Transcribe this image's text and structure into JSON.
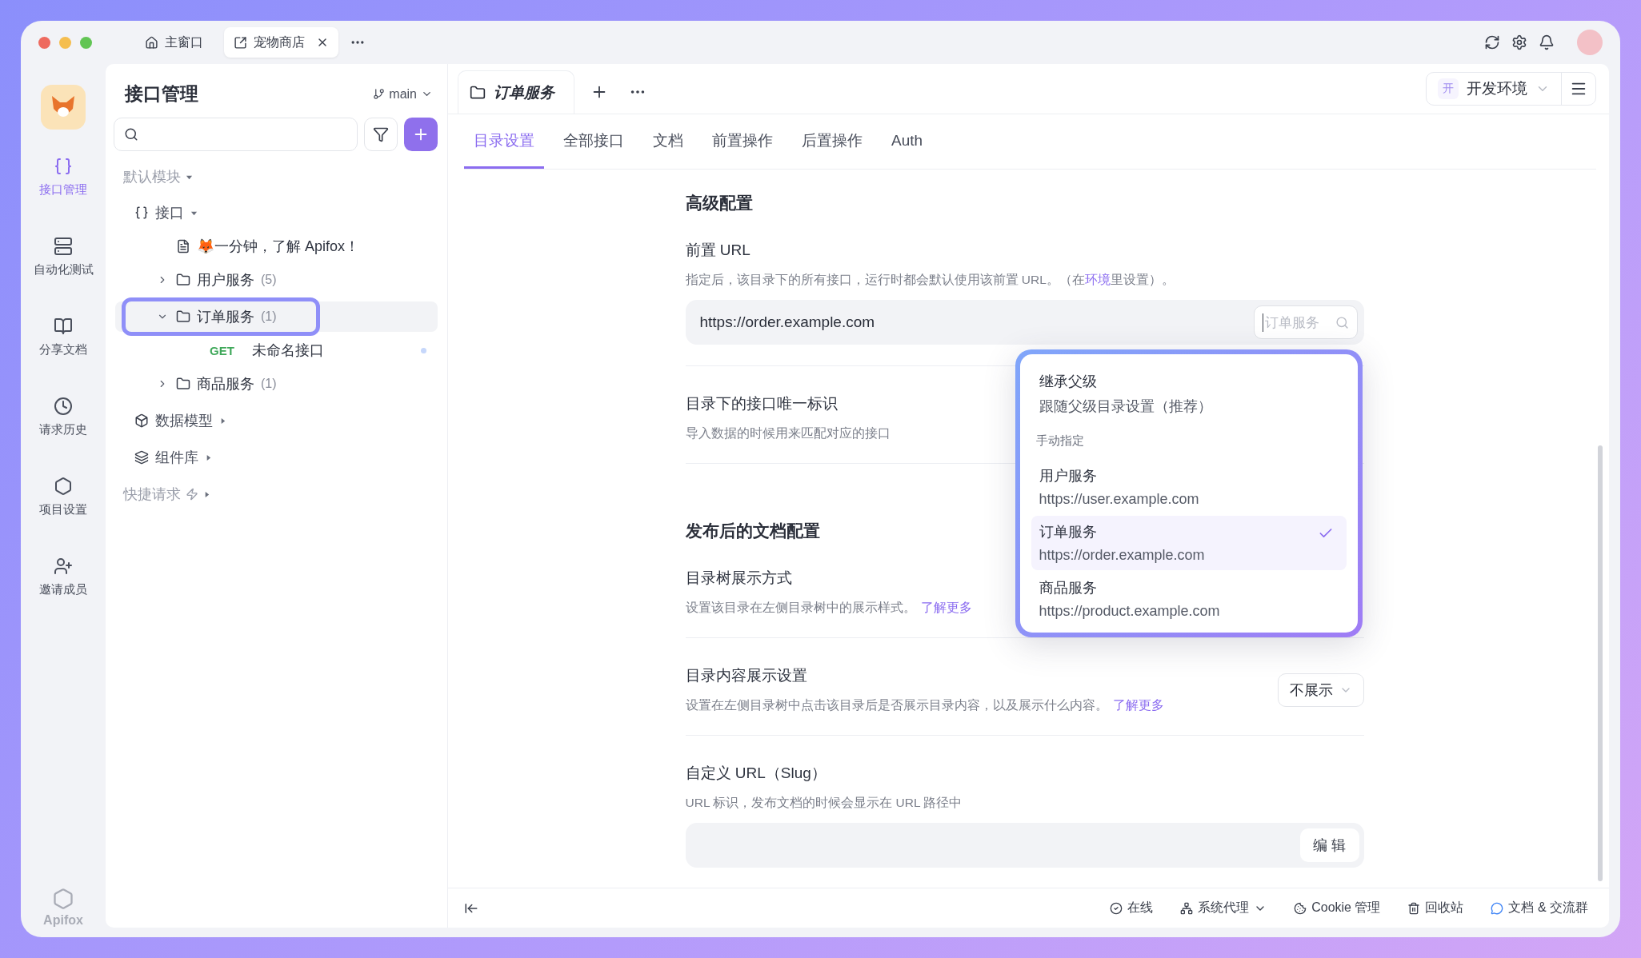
{
  "window": {
    "tabs": [
      {
        "label": "主窗口",
        "selected": false,
        "kind": "home"
      },
      {
        "label": "宠物商店",
        "selected": true,
        "kind": "project"
      }
    ]
  },
  "nav": {
    "items": [
      {
        "label": "接口管理",
        "selected": true
      },
      {
        "label": "自动化测试",
        "selected": false
      },
      {
        "label": "分享文档",
        "selected": false
      },
      {
        "label": "请求历史",
        "selected": false
      },
      {
        "label": "项目设置",
        "selected": false
      },
      {
        "label": "邀请成员",
        "selected": false
      }
    ],
    "brand": "Apifox"
  },
  "sidebar": {
    "title": "接口管理",
    "branch": "main",
    "module": "默认模块",
    "tree": [
      {
        "kind": "root",
        "label": "接口",
        "expanded": true,
        "children": [
          {
            "kind": "doc",
            "label": "🦊一分钟，了解 Apifox！"
          },
          {
            "kind": "folder",
            "label": "用户服务",
            "count": "(5)",
            "expanded": false,
            "selected": false
          },
          {
            "kind": "folder",
            "label": "订单服务",
            "count": "(1)",
            "expanded": true,
            "selected": true,
            "children": [
              {
                "kind": "endpoint",
                "method": "GET",
                "label": "未命名接口"
              }
            ]
          },
          {
            "kind": "folder",
            "label": "商品服务",
            "count": "(1)",
            "expanded": false,
            "selected": false
          }
        ]
      },
      {
        "kind": "root",
        "label": "数据模型",
        "expanded": false
      },
      {
        "kind": "root",
        "label": "组件库",
        "expanded": false
      }
    ],
    "quick": "快捷请求"
  },
  "main": {
    "doc_tab": "订单服务",
    "env_badge": "开",
    "env": "开发环境",
    "tabs": [
      {
        "label": "目录设置",
        "selected": true
      },
      {
        "label": "全部接口",
        "selected": false
      },
      {
        "label": "文档",
        "selected": false
      },
      {
        "label": "前置操作",
        "selected": false
      },
      {
        "label": "后置操作",
        "selected": false
      },
      {
        "label": "Auth",
        "selected": false
      }
    ],
    "advanced": {
      "heading": "高级配置",
      "base_url": {
        "label": "前置 URL",
        "desc_before": "指定后，该目录下的所有接口，运行时都会默认使用该前置 URL。（在",
        "desc_link": "环境",
        "desc_after": "里设置）。",
        "value": "https://order.example.com",
        "search_placeholder": "订单服务"
      },
      "unique_id": {
        "label": "目录下的接口唯一标识",
        "desc": "导入数据的时候用来匹配对应的接口"
      }
    },
    "publish": {
      "heading": "发布后的文档配置",
      "tree_style": {
        "label": "目录树展示方式",
        "desc": "设置该目录在左侧目录树中的展示样式。",
        "link": "了解更多"
      },
      "content": {
        "label": "目录内容展示设置",
        "desc": "设置在左侧目录树中点击该目录后是否展示目录内容，以及展示什么内容。",
        "link": "了解更多",
        "select": "不展示"
      },
      "slug": {
        "label": "自定义 URL（Slug）",
        "desc": "URL 标识，发布文档的时候会显示在 URL 路径中",
        "button": "编 辑"
      }
    },
    "dropdown": {
      "inherit": {
        "title": "继承父级",
        "subtitle": "跟随父级目录设置（推荐）",
        "selected": false
      },
      "group": "手动指定",
      "options": [
        {
          "title": "用户服务",
          "subtitle": "https://user.example.com",
          "selected": false
        },
        {
          "title": "订单服务",
          "subtitle": "https://order.example.com",
          "selected": true
        },
        {
          "title": "商品服务",
          "subtitle": "https://product.example.com",
          "selected": false
        }
      ]
    }
  },
  "status_bar": [
    {
      "kind": "online",
      "label": "在线"
    },
    {
      "kind": "proxy",
      "label": "系统代理"
    },
    {
      "kind": "cookie",
      "label": "Cookie 管理"
    },
    {
      "kind": "trash",
      "label": "回收站"
    },
    {
      "kind": "community",
      "label": "文档 & 交流群"
    }
  ]
}
